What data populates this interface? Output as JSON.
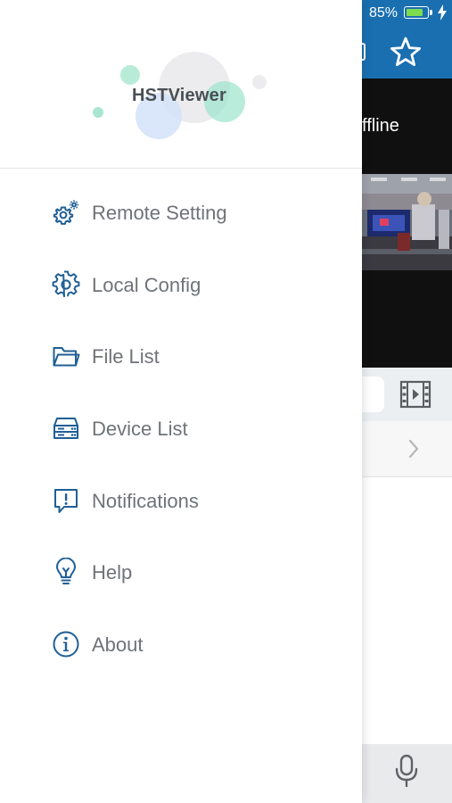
{
  "status": {
    "battery_percent_label": "85%",
    "battery_level": 0.85
  },
  "background": {
    "offline_label": "ffline"
  },
  "drawer": {
    "logo_text": "HSTViewer",
    "items": [
      {
        "label": "Remote Setting",
        "icon": "remote-setting-icon"
      },
      {
        "label": "Local Config",
        "icon": "gear-icon"
      },
      {
        "label": "File List",
        "icon": "folder-icon"
      },
      {
        "label": "Device List",
        "icon": "device-icon"
      },
      {
        "label": "Notifications",
        "icon": "notification-icon"
      },
      {
        "label": "Help",
        "icon": "lightbulb-icon"
      },
      {
        "label": "About",
        "icon": "info-icon"
      }
    ]
  },
  "colors": {
    "accent": "#1a6fb0",
    "icon": "#1f5f95",
    "menu_text": "#6f7378"
  }
}
